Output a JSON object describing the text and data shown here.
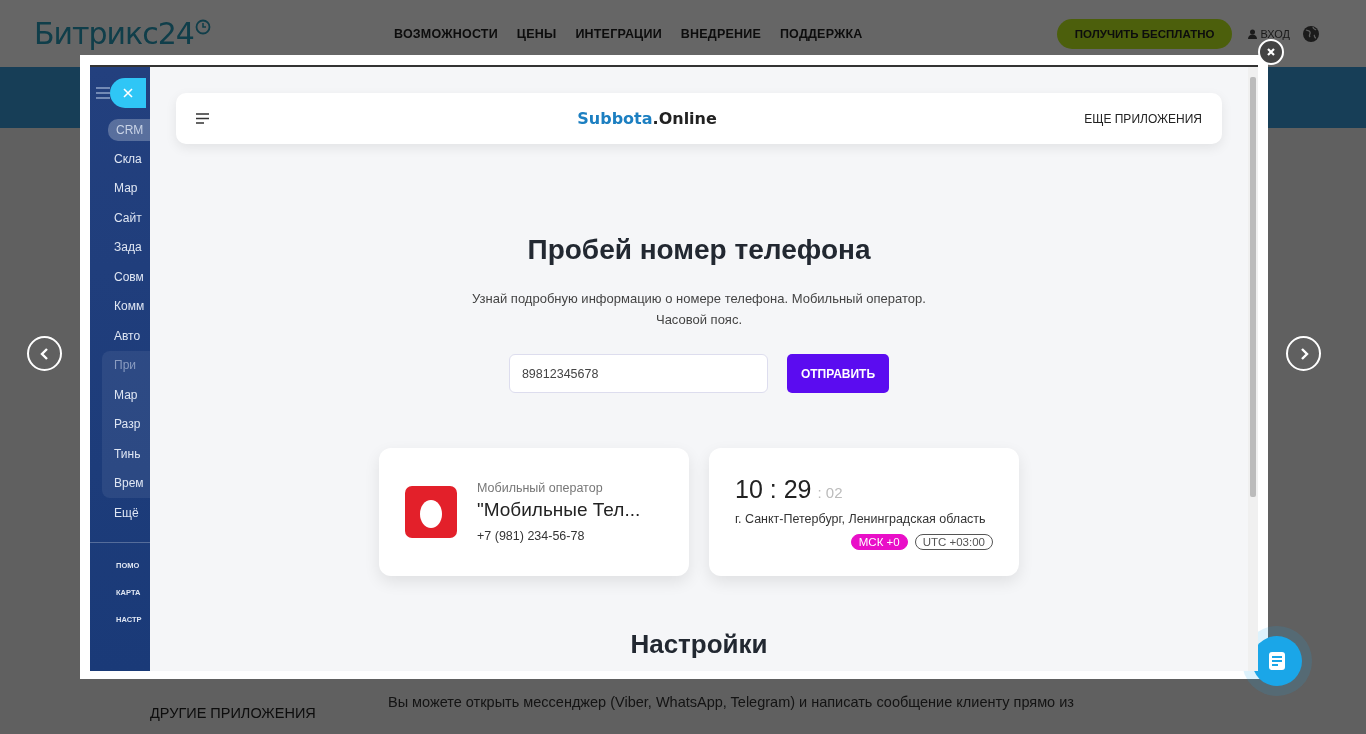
{
  "site_header": {
    "logo": "Битрикс24",
    "nav": [
      "ВОЗМОЖНОСТИ",
      "ЦЕНЫ",
      "ИНТЕГРАЦИИ",
      "ВНЕДРЕНИЕ",
      "ПОДДЕРЖКА"
    ],
    "cta": "ПОЛУЧИТЬ БЕСПЛАТНО",
    "login": "ВХОД"
  },
  "page_section": {
    "title": "ДРУГИЕ ПРИЛОЖЕНИЯ",
    "text": "Вы можете открыть мессенджер (Viber, WhatsApp, Telegram) и написать сообщение клиенту прямо из"
  },
  "lightbox": {
    "sidebar": {
      "items": [
        {
          "label": "CRM",
          "selected": true
        },
        {
          "label": "Скла",
          "selected": false
        },
        {
          "label": "Мар",
          "selected": false
        },
        {
          "label": "Сайт",
          "selected": false
        },
        {
          "label": "Зада",
          "selected": false
        },
        {
          "label": "Совм",
          "selected": false
        },
        {
          "label": "Комм",
          "selected": false
        },
        {
          "label": "Авто",
          "selected": false
        },
        {
          "label": "При",
          "selected": false,
          "children": [
            {
              "label": "Мар",
              "selected": false
            },
            {
              "label": "Разр",
              "selected": false
            },
            {
              "label": "Тинь",
              "selected": false
            },
            {
              "label": "Врем",
              "selected": false
            }
          ]
        },
        {
          "label": "Ещё",
          "selected": false
        }
      ],
      "footer_items": [
        "ПОМО",
        "КАРТА",
        "НАСТР"
      ]
    },
    "app": {
      "brand_prefix": "Subbota",
      "brand_suffix": ".Online",
      "more_apps": "ЕЩЕ ПРИЛОЖЕНИЯ",
      "heading": "Пробей номер телефона",
      "description": "Узнай подробную информацию о номере телефона. Мобильный оператор. Часовой пояс.",
      "phone_value": "89812345678",
      "submit": "ОТПРАВИТЬ",
      "operator": {
        "label": "Мобильный оператор",
        "name": "\"Мобильные Тел...",
        "phone": "+7 (981) 234-56-78"
      },
      "time": {
        "hours_minutes": "10 : 29",
        "seconds": ": 02",
        "region": "г. Санкт-Петербург, Ленинградская область",
        "badges": [
          {
            "text": "МСК +0",
            "kind": "filled",
            "color": "#e90fc8"
          },
          {
            "text": "UTC +03:00",
            "kind": "outline",
            "color": "#555555"
          }
        ]
      },
      "next_heading": "Настройки"
    }
  }
}
